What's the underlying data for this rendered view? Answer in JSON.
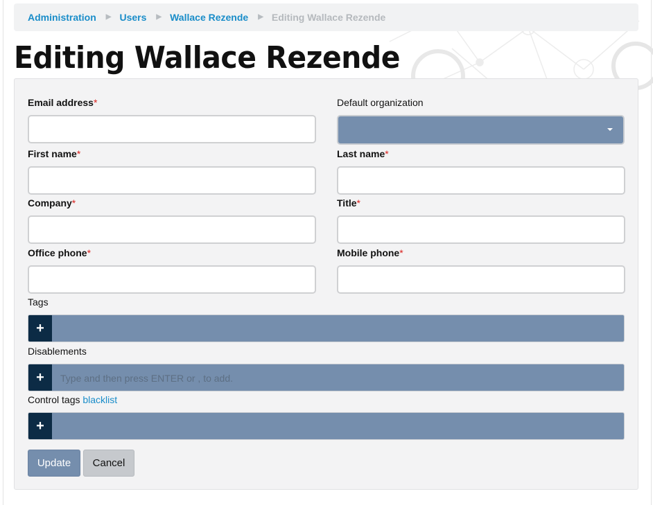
{
  "breadcrumb": {
    "items": [
      "Administration",
      "Users",
      "Wallace Rezende"
    ],
    "current": "Editing Wallace Rezende",
    "separator": "▶"
  },
  "page": {
    "title": "Editing Wallace Rezende"
  },
  "form": {
    "email": {
      "label": "Email address",
      "required": "*",
      "value": ""
    },
    "default_org": {
      "label": "Default organization",
      "value": ""
    },
    "first_name": {
      "label": "First name",
      "required": "*",
      "value": ""
    },
    "last_name": {
      "label": "Last name",
      "required": "*",
      "value": ""
    },
    "company": {
      "label": "Company",
      "required": "*",
      "value": ""
    },
    "title": {
      "label": "Title",
      "required": "*",
      "value": ""
    },
    "office_phone": {
      "label": "Office phone",
      "required": "*",
      "value": ""
    },
    "mobile_phone": {
      "label": "Mobile phone",
      "required": "*",
      "value": ""
    },
    "tags": {
      "label": "Tags",
      "add": "+"
    },
    "disablements": {
      "label": "Disablements",
      "add": "+",
      "placeholder": "Type and then press ENTER or , to add."
    },
    "control_tags": {
      "label": "Control tags",
      "link": "blacklist",
      "add": "+"
    }
  },
  "buttons": {
    "update": "Update",
    "cancel": "Cancel"
  },
  "colors": {
    "accent": "#758ead",
    "link": "#1a8dc9",
    "tag_add": "#0c2b45",
    "required": "#d9231f"
  }
}
